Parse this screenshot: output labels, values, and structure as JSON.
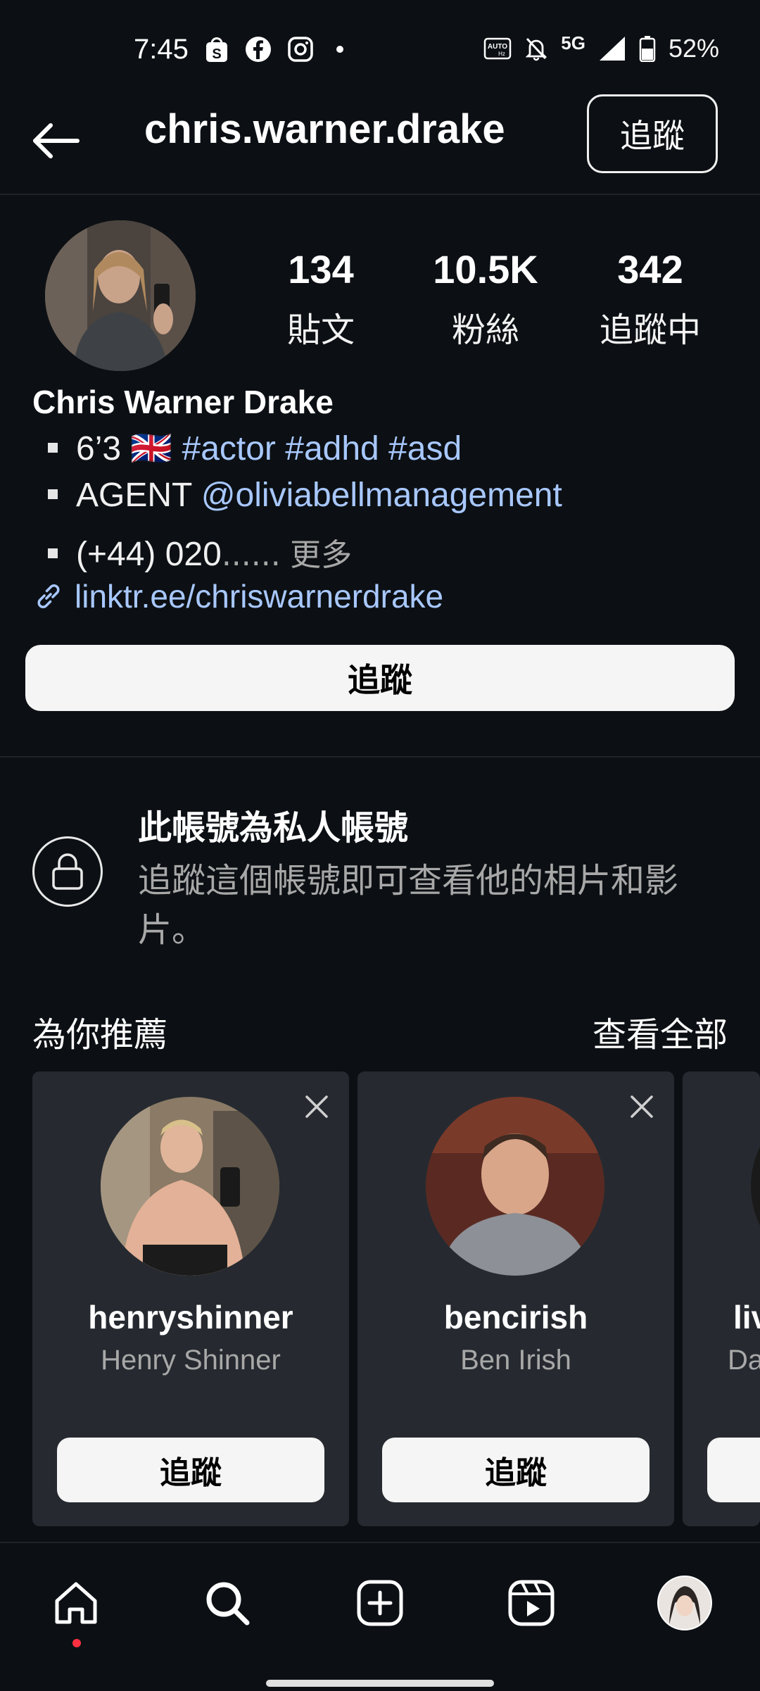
{
  "status_bar": {
    "time": "7:45",
    "battery": "52%",
    "network": "5G",
    "icons_left": [
      "shopee-icon",
      "facebook-icon",
      "instagram-icon",
      "dot-icon"
    ],
    "icons_right": [
      "auto-hz-icon",
      "bell-off-icon",
      "5g-icon",
      "signal-icon",
      "battery-icon"
    ]
  },
  "header": {
    "username": "chris.warner.drake",
    "follow_label": "追蹤"
  },
  "profile": {
    "stats": [
      {
        "value": "134",
        "label": "貼文"
      },
      {
        "value": "10.5K",
        "label": "粉絲"
      },
      {
        "value": "342",
        "label": "追蹤中"
      }
    ],
    "full_name": "Chris Warner Drake",
    "bio": {
      "line1_text": "6’3 🇬🇧",
      "line1_tags": "#actor #adhd #asd",
      "line2_text": "AGENT",
      "line2_mention": "@oliviabellmanagement",
      "line3_text": "(+44) 020",
      "line3_ellipsis": "......",
      "line3_more": "更多"
    },
    "link": "linktr.ee/chriswarnerdrake",
    "follow_button": "追蹤"
  },
  "private_notice": {
    "title": "此帳號為私人帳號",
    "description": "追蹤這個帳號即可查看他的相片和影片。"
  },
  "suggestions": {
    "title": "為你推薦",
    "see_all": "查看全部",
    "cards": [
      {
        "username": "henryshinner",
        "name": "Henry Shinner",
        "button": "追蹤"
      },
      {
        "username": "bencirish",
        "name": "Ben Irish",
        "button": "追蹤"
      },
      {
        "username": "liv",
        "name": "Da",
        "button": ""
      }
    ]
  },
  "bottom_nav": {
    "items": [
      "home-icon",
      "search-icon",
      "create-icon",
      "reels-icon",
      "profile-avatar"
    ]
  },
  "colors": {
    "background": "#0c1014",
    "link": "#a8c8ff",
    "card": "#262a30",
    "muted": "#a8a8a8",
    "notification_dot": "#ff3040"
  }
}
